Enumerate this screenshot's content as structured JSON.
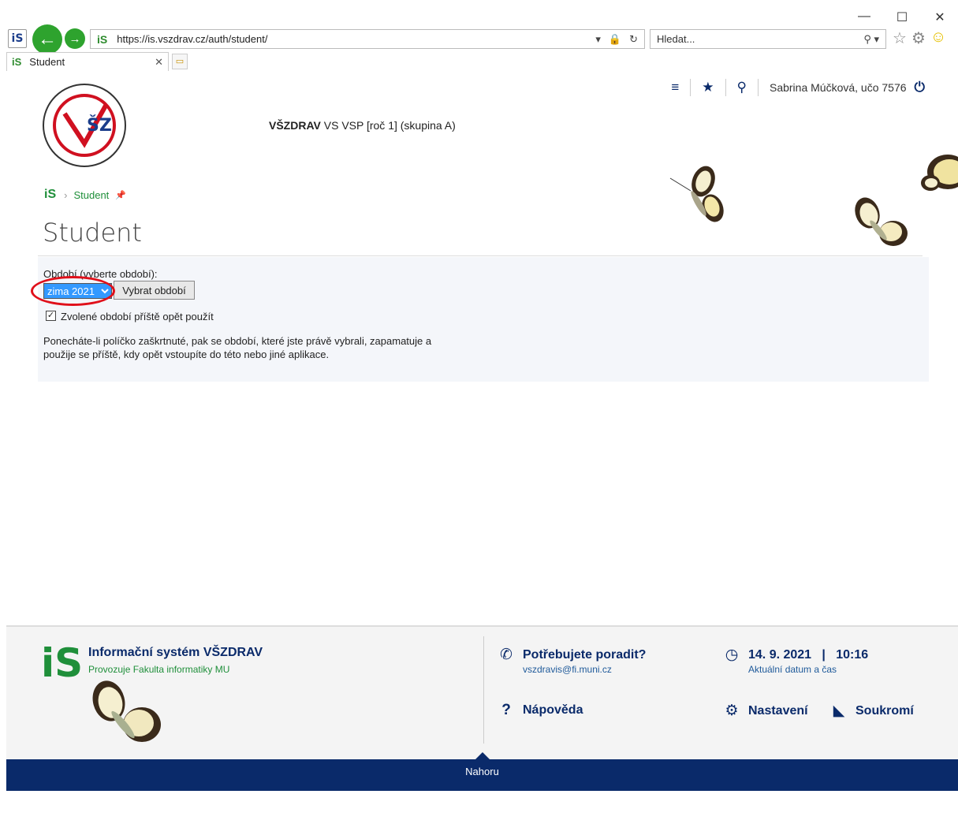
{
  "window": {
    "minimize": "—",
    "maximize": "☐",
    "close": "✕"
  },
  "browser": {
    "site_icon": "iS",
    "url": "https://is.vszdrav.cz/auth/student/",
    "search_placeholder": "Hledat...",
    "tab_title": "Student"
  },
  "header": {
    "org": "VŠZDRAV",
    "study": "VS VSP [roč 1] (skupina A)",
    "user": "Sabrina Múčková, učo 7576"
  },
  "breadcrumb": {
    "root_icon": "iS",
    "current": "Student"
  },
  "page": {
    "title": "Student"
  },
  "period": {
    "label": "Období (vyberte období):",
    "selected": "zima 2021",
    "button": "Vybrat období",
    "checkbox_label": "Zvolené období příště opět použít",
    "checked": true,
    "note": "Ponecháte-li políčko zaškrtnuté, pak se období, které jste právě vybrali, zapamatuje a použije se příště, kdy opět vstoupíte do této nebo jiné aplikace."
  },
  "footer": {
    "logo": "iS",
    "title": "Informační systém VŠZDRAV",
    "subtitle": "Provozuje Fakulta informatiky MU",
    "help_title": "Potřebujete poradit?",
    "help_email": "vszdravis@fi.muni.cz",
    "datetime": "14. 9. 2021   |   10:16",
    "datetime_label": "Aktuální datum a čas",
    "napoveda": "Nápověda",
    "nastaveni": "Nastavení",
    "soukromi": "Soukromí",
    "nahoru": "Nahoru"
  }
}
